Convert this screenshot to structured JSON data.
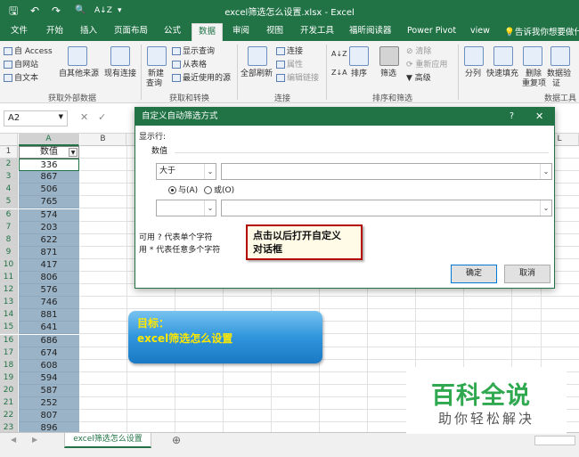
{
  "window": {
    "title": "excel筛选怎么设置.xlsx  -  Excel"
  },
  "qat": {
    "save": "🖫",
    "undo": "↶",
    "redo": "↷",
    "preview": "🔍",
    "sort": "A↓Z",
    "more": "▾"
  },
  "tabs": [
    "文件",
    "开始",
    "插入",
    "页面布局",
    "公式",
    "数据",
    "审阅",
    "视图",
    "开发工具",
    "福昕阅读器",
    "Power Pivot",
    "view"
  ],
  "active_tab": "数据",
  "tell_me": "告诉我你想要做什么",
  "ribbon": {
    "ext": {
      "access": "自 Access",
      "web": "自网站",
      "text": "自文本",
      "other": "自其他来源",
      "existing": "现有连接",
      "group": "获取外部数据"
    },
    "transform": {
      "new_query": "新建",
      "new_query2": "查询",
      "show_queries": "显示查询",
      "from_table": "从表格",
      "recent": "最近使用的源",
      "group": "获取和转换"
    },
    "conn": {
      "refresh": "全部刷新",
      "connections": "连接",
      "properties": "属性",
      "edit_links": "编辑链接",
      "group": "连接"
    },
    "sort": {
      "sort": "排序",
      "filter": "筛选",
      "clear": "清除",
      "reapply": "重新应用",
      "advanced": "高级",
      "group": "排序和筛选"
    },
    "tools": {
      "split": "分列",
      "flash": "快速填充",
      "dup": "删除",
      "dup2": "重复项",
      "valid": "数据验",
      "valid2": "证",
      "group": "数据工具"
    }
  },
  "formula_bar": {
    "namebox": "A2",
    "cancel": "✕",
    "enter": "✓"
  },
  "grid": {
    "columns": [
      "A",
      "B",
      "L"
    ],
    "header_cell": "数值",
    "rows": [
      "1",
      "2",
      "3",
      "4",
      "5",
      "6",
      "7",
      "8",
      "9",
      "10",
      "11",
      "12",
      "13",
      "14",
      "15",
      "16",
      "17",
      "18",
      "19",
      "20",
      "21",
      "22",
      "23",
      "24"
    ],
    "values": [
      "336",
      "867",
      "506",
      "765",
      "574",
      "203",
      "622",
      "871",
      "417",
      "806",
      "576",
      "746",
      "881",
      "641",
      "686",
      "674",
      "608",
      "594",
      "587",
      "252",
      "807",
      "896"
    ]
  },
  "sheet": {
    "tab": "excel筛选怎么设置",
    "add": "⊕"
  },
  "dialog": {
    "title": "自定义自动筛选方式",
    "help": "?",
    "close": "✕",
    "show_rows": "显示行:",
    "field": "数值",
    "op1": "大于",
    "val1": "",
    "and_label": "与(A)",
    "or_label": "或(O)",
    "op2": "",
    "val2": "",
    "hint1": "可用 ? 代表单个字符",
    "hint2": "用 * 代表任意多个字符",
    "ok": "确定",
    "cancel": "取消"
  },
  "annotation": {
    "line1": "点击以后打开自定义",
    "line2": "对话框"
  },
  "goal": {
    "line1": "目标：",
    "line2": "excel筛选怎么设置"
  },
  "watermark": {
    "line1": "百科全说",
    "line2": "助你轻松解决"
  }
}
